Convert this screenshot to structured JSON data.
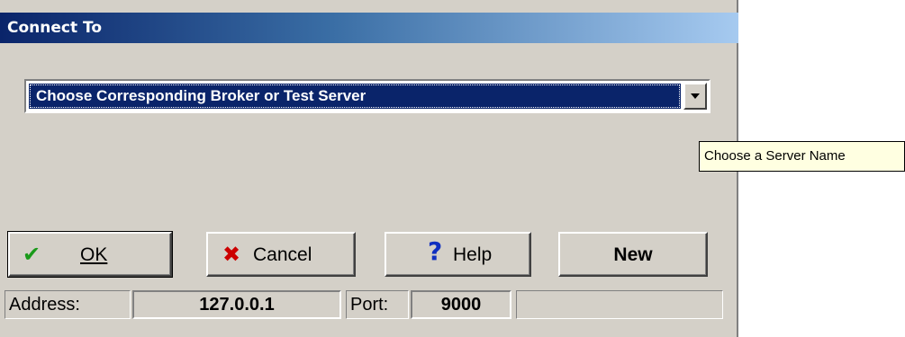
{
  "window": {
    "title": "Connect To"
  },
  "server_select": {
    "selected_value": "Choose Corresponding Broker or Test Server",
    "tooltip": "Choose a Server Name"
  },
  "buttons": {
    "ok": {
      "label": "OK",
      "icon": "checkmark-icon",
      "icon_color": "#1a9a1a"
    },
    "cancel": {
      "label": "Cancel",
      "icon": "x-icon",
      "icon_color": "#cc0000"
    },
    "help": {
      "label": "Help",
      "icon": "question-icon",
      "icon_color": "#1030c0"
    },
    "new": {
      "label": "New"
    }
  },
  "status": {
    "address_label": "Address:",
    "address_value": "127.0.0.1",
    "port_label": "Port:",
    "port_value": "9000"
  },
  "colors": {
    "title_gradient_start": "#0a246a",
    "title_gradient_end": "#a6caf0",
    "selection_bg": "#0a246a",
    "dialog_bg": "#d4d0c8",
    "tooltip_bg": "#ffffe1"
  }
}
